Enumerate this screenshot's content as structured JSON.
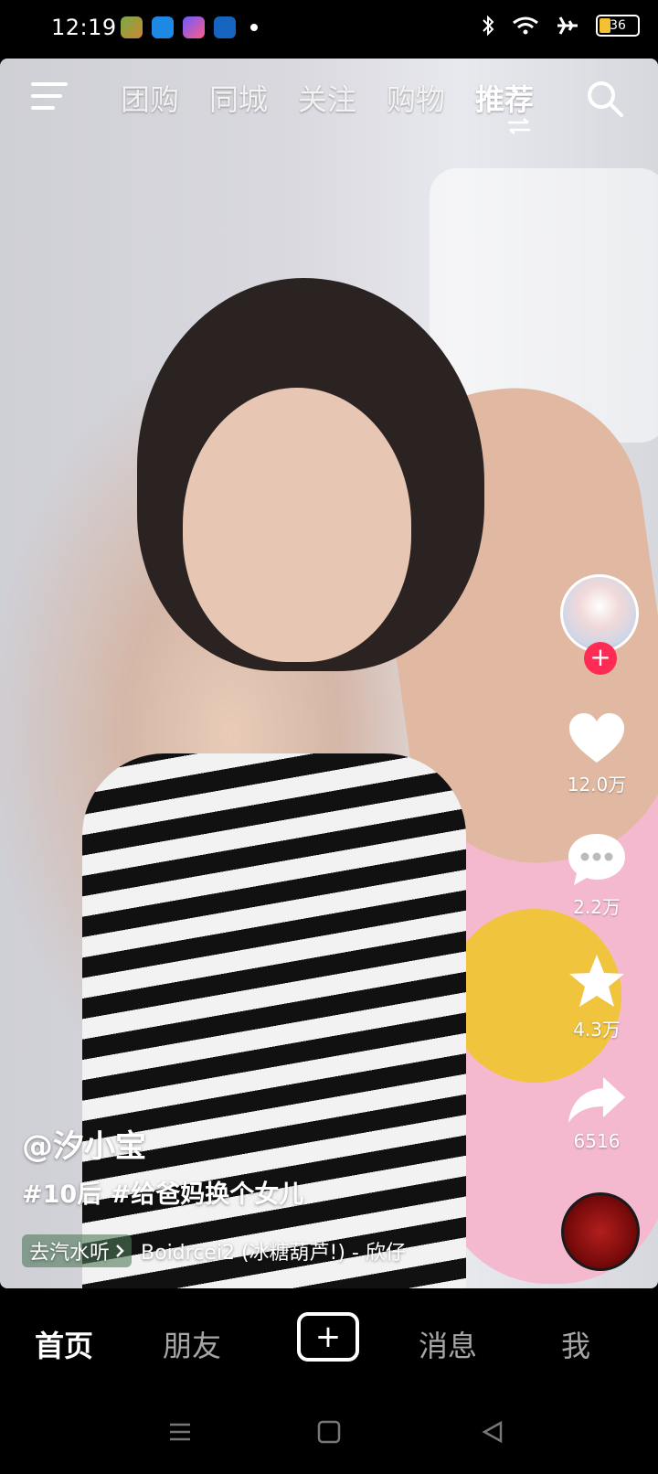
{
  "status_bar": {
    "time": "12:19",
    "battery": "36",
    "icons": [
      "app-game-icon",
      "app-browser-icon",
      "app-shortcut-icon",
      "app-blue-icon",
      "notification-dot-icon",
      "bluetooth-icon",
      "wifi-icon",
      "airplane-mode-icon",
      "battery-icon"
    ]
  },
  "top_tabs": [
    {
      "label": "团购"
    },
    {
      "label": "同城"
    },
    {
      "label": "关注"
    },
    {
      "label": "购物"
    },
    {
      "label": "推荐",
      "active": true
    }
  ],
  "actions": {
    "likes": "12.0万",
    "comments": "2.2万",
    "favorites": "4.3万",
    "shares": "6516"
  },
  "caption": {
    "author": "@汐小宝",
    "tags": "#10后 #给爸妈换个女儿",
    "music_prefix": "去汽水听",
    "music_title": "Boidrcei2 (冰糖葫芦!) - 欣仔"
  },
  "bottom_nav": [
    {
      "label": "首页",
      "active": true
    },
    {
      "label": "朋友"
    },
    {
      "label": "消息"
    },
    {
      "label": "我"
    }
  ],
  "colors": {
    "accent": "#fe2c55",
    "background": "#000000"
  }
}
